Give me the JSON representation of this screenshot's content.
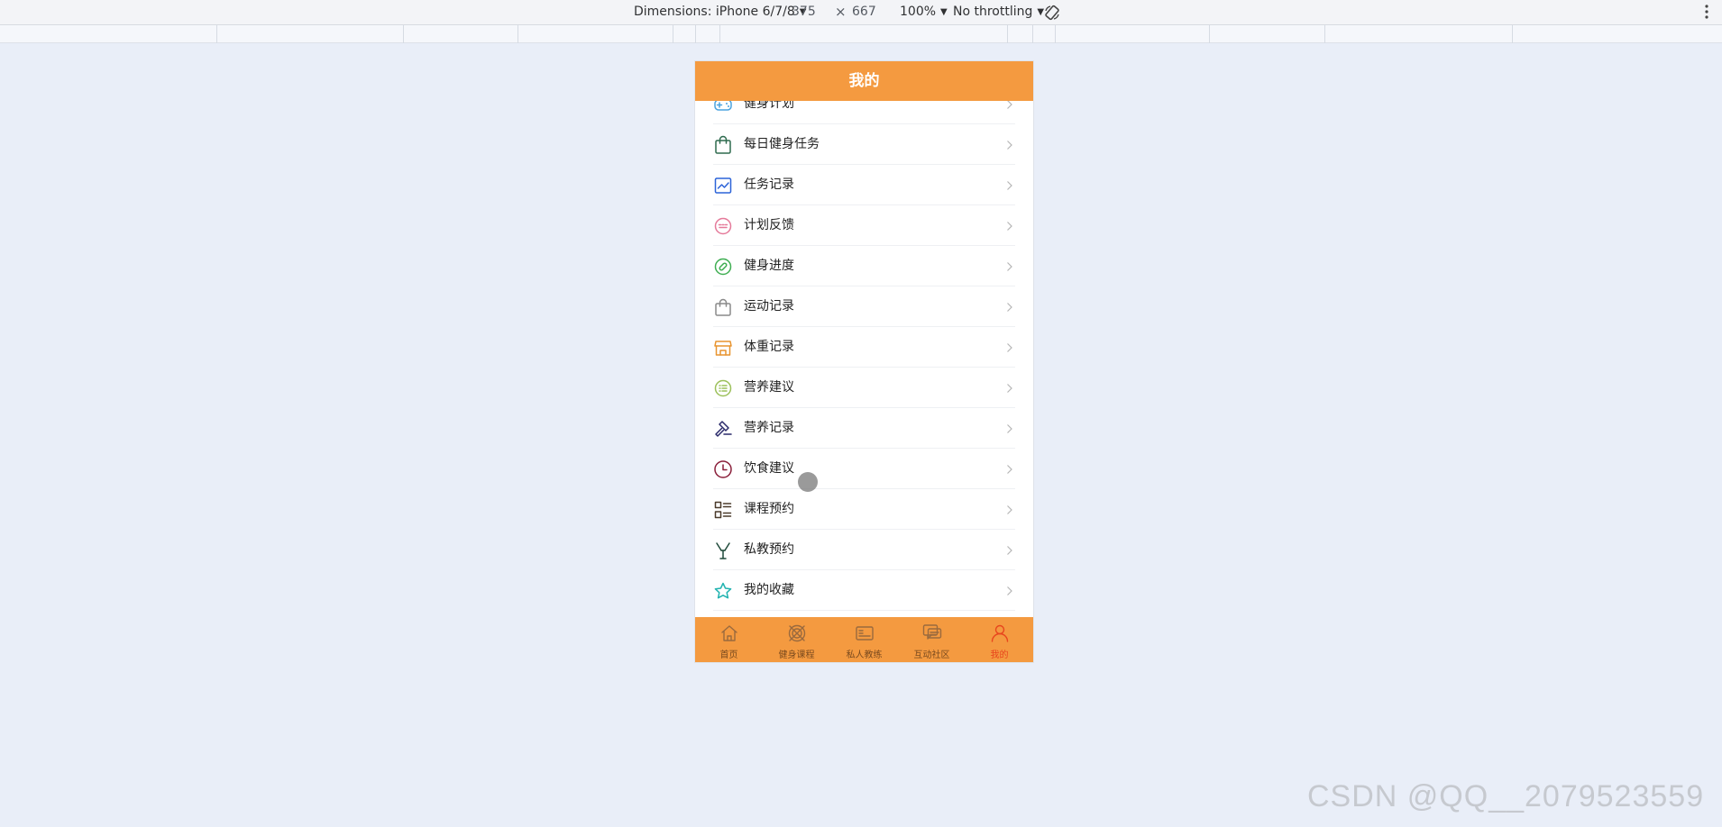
{
  "devtools": {
    "dimensions_label": "Dimensions: iPhone 6/7/8",
    "width": "375",
    "times": "×",
    "height": "667",
    "zoom": "100%",
    "throttling": "No throttling"
  },
  "page": {
    "title": "我的"
  },
  "menu": {
    "items": [
      {
        "label": "健身计划",
        "icon": "gamepad-icon",
        "color": "#4aa3df"
      },
      {
        "label": "每日健身任务",
        "icon": "shopping-bag-icon",
        "color": "#2f6b4f"
      },
      {
        "label": "任务记录",
        "icon": "line-chart-icon",
        "color": "#2c63d8"
      },
      {
        "label": "计划反馈",
        "icon": "keyboard-icon",
        "color": "#e57a9a"
      },
      {
        "label": "健身进度",
        "icon": "bandage-icon",
        "color": "#3fae52"
      },
      {
        "label": "运动记录",
        "icon": "bag-icon",
        "color": "#8a8a8a"
      },
      {
        "label": "体重记录",
        "icon": "shop-icon",
        "color": "#e8942f"
      },
      {
        "label": "营养建议",
        "icon": "list-circle-icon",
        "color": "#9cc05a"
      },
      {
        "label": "营养记录",
        "icon": "hammer-icon",
        "color": "#2a2a6a"
      },
      {
        "label": "饮食建议",
        "icon": "clock-icon",
        "color": "#8a1f3a"
      },
      {
        "label": "课程预约",
        "icon": "list-grid-icon",
        "color": "#4a3a2a"
      },
      {
        "label": "私教预约",
        "icon": "fork-icon",
        "color": "#1f4a3a"
      },
      {
        "label": "我的收藏",
        "icon": "star-icon",
        "color": "#22b3b0"
      }
    ]
  },
  "tabbar": {
    "tabs": [
      {
        "label": "首页",
        "icon": "home-icon"
      },
      {
        "label": "健身课程",
        "icon": "grid-icon"
      },
      {
        "label": "私人教练",
        "icon": "card-icon"
      },
      {
        "label": "互动社区",
        "icon": "chat-icon"
      },
      {
        "label": "我的",
        "icon": "user-icon"
      }
    ],
    "active_index": 4
  },
  "watermark": "CSDN @QQ__2079523559"
}
